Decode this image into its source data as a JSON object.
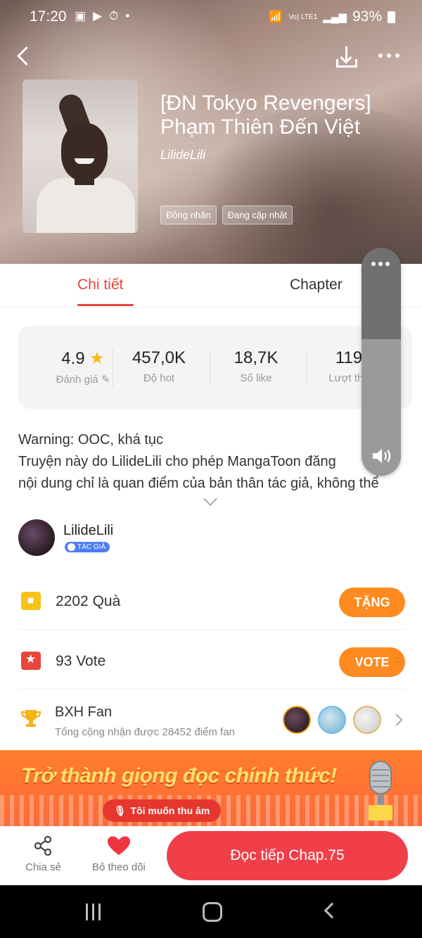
{
  "status_bar": {
    "time": "17:20",
    "network": "Vo) LTE1",
    "battery": "93%"
  },
  "header": {
    "title": "[ĐN Tokyo Revengers] Phạm Thiên Đến Việt",
    "author": "LilideLili",
    "tags": [
      "Đồng nhân",
      "Đang cập nhật"
    ]
  },
  "tabs": [
    {
      "label": "Chi tiết",
      "active": true
    },
    {
      "label": "Chapter",
      "active": false
    }
  ],
  "stats": [
    {
      "value": "4.9",
      "label": "Đánh giá"
    },
    {
      "value": "457,0K",
      "label": "Độ hot"
    },
    {
      "value": "18,7K",
      "label": "Số like"
    },
    {
      "value": "119",
      "label": "Lượt the"
    }
  ],
  "description": {
    "lines": [
      "Warning: OOC, khá tục",
      "Truyện này do LilideLili cho phép MangaToon đăng",
      "nội dung chỉ là quan điểm của bản thân tác giả, không thể"
    ]
  },
  "author_block": {
    "name": "LilideLili",
    "badge": "TÁC GIẢ"
  },
  "gifts": {
    "count": "2202",
    "label": "Quà",
    "button": "TẶNG"
  },
  "votes": {
    "count": "93",
    "label": "Vote",
    "button": "VOTE"
  },
  "fan_ranking": {
    "title": "BXH Fan",
    "subtitle": "Tổng cộng nhận được 28452 điểm fan"
  },
  "banner": {
    "headline": "Trở thành giọng đọc chính thức!",
    "cta": "Tôi muốn thu âm"
  },
  "bottom_actions": {
    "share": "Chia sẻ",
    "unfollow": "Bỏ theo dõi",
    "read": "Đọc tiếp Chap.75"
  },
  "colors": {
    "accent": "#e8453c",
    "orange": "#ff8a1f",
    "read_button": "#f13f4a",
    "star": "#f7b918"
  }
}
